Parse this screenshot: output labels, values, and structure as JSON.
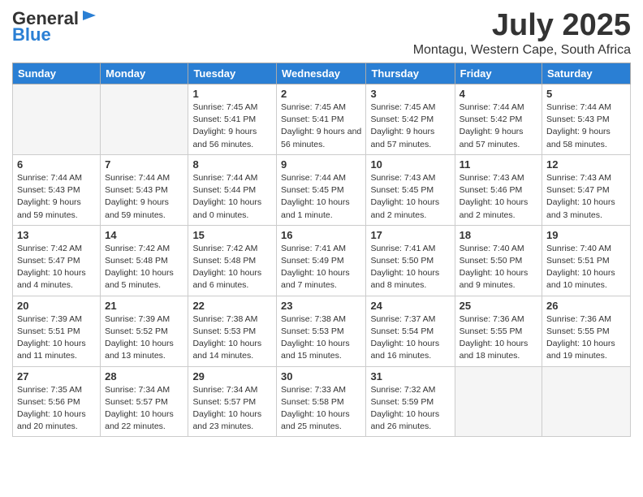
{
  "logo": {
    "general": "General",
    "blue": "Blue"
  },
  "title": "July 2025",
  "location": "Montagu, Western Cape, South Africa",
  "days_of_week": [
    "Sunday",
    "Monday",
    "Tuesday",
    "Wednesday",
    "Thursday",
    "Friday",
    "Saturday"
  ],
  "weeks": [
    [
      {
        "day": "",
        "info": ""
      },
      {
        "day": "",
        "info": ""
      },
      {
        "day": "1",
        "info": "Sunrise: 7:45 AM\nSunset: 5:41 PM\nDaylight: 9 hours and 56 minutes."
      },
      {
        "day": "2",
        "info": "Sunrise: 7:45 AM\nSunset: 5:41 PM\nDaylight: 9 hours and 56 minutes."
      },
      {
        "day": "3",
        "info": "Sunrise: 7:45 AM\nSunset: 5:42 PM\nDaylight: 9 hours and 57 minutes."
      },
      {
        "day": "4",
        "info": "Sunrise: 7:44 AM\nSunset: 5:42 PM\nDaylight: 9 hours and 57 minutes."
      },
      {
        "day": "5",
        "info": "Sunrise: 7:44 AM\nSunset: 5:43 PM\nDaylight: 9 hours and 58 minutes."
      }
    ],
    [
      {
        "day": "6",
        "info": "Sunrise: 7:44 AM\nSunset: 5:43 PM\nDaylight: 9 hours and 59 minutes."
      },
      {
        "day": "7",
        "info": "Sunrise: 7:44 AM\nSunset: 5:43 PM\nDaylight: 9 hours and 59 minutes."
      },
      {
        "day": "8",
        "info": "Sunrise: 7:44 AM\nSunset: 5:44 PM\nDaylight: 10 hours and 0 minutes."
      },
      {
        "day": "9",
        "info": "Sunrise: 7:44 AM\nSunset: 5:45 PM\nDaylight: 10 hours and 1 minute."
      },
      {
        "day": "10",
        "info": "Sunrise: 7:43 AM\nSunset: 5:45 PM\nDaylight: 10 hours and 2 minutes."
      },
      {
        "day": "11",
        "info": "Sunrise: 7:43 AM\nSunset: 5:46 PM\nDaylight: 10 hours and 2 minutes."
      },
      {
        "day": "12",
        "info": "Sunrise: 7:43 AM\nSunset: 5:47 PM\nDaylight: 10 hours and 3 minutes."
      }
    ],
    [
      {
        "day": "13",
        "info": "Sunrise: 7:42 AM\nSunset: 5:47 PM\nDaylight: 10 hours and 4 minutes."
      },
      {
        "day": "14",
        "info": "Sunrise: 7:42 AM\nSunset: 5:48 PM\nDaylight: 10 hours and 5 minutes."
      },
      {
        "day": "15",
        "info": "Sunrise: 7:42 AM\nSunset: 5:48 PM\nDaylight: 10 hours and 6 minutes."
      },
      {
        "day": "16",
        "info": "Sunrise: 7:41 AM\nSunset: 5:49 PM\nDaylight: 10 hours and 7 minutes."
      },
      {
        "day": "17",
        "info": "Sunrise: 7:41 AM\nSunset: 5:50 PM\nDaylight: 10 hours and 8 minutes."
      },
      {
        "day": "18",
        "info": "Sunrise: 7:40 AM\nSunset: 5:50 PM\nDaylight: 10 hours and 9 minutes."
      },
      {
        "day": "19",
        "info": "Sunrise: 7:40 AM\nSunset: 5:51 PM\nDaylight: 10 hours and 10 minutes."
      }
    ],
    [
      {
        "day": "20",
        "info": "Sunrise: 7:39 AM\nSunset: 5:51 PM\nDaylight: 10 hours and 11 minutes."
      },
      {
        "day": "21",
        "info": "Sunrise: 7:39 AM\nSunset: 5:52 PM\nDaylight: 10 hours and 13 minutes."
      },
      {
        "day": "22",
        "info": "Sunrise: 7:38 AM\nSunset: 5:53 PM\nDaylight: 10 hours and 14 minutes."
      },
      {
        "day": "23",
        "info": "Sunrise: 7:38 AM\nSunset: 5:53 PM\nDaylight: 10 hours and 15 minutes."
      },
      {
        "day": "24",
        "info": "Sunrise: 7:37 AM\nSunset: 5:54 PM\nDaylight: 10 hours and 16 minutes."
      },
      {
        "day": "25",
        "info": "Sunrise: 7:36 AM\nSunset: 5:55 PM\nDaylight: 10 hours and 18 minutes."
      },
      {
        "day": "26",
        "info": "Sunrise: 7:36 AM\nSunset: 5:55 PM\nDaylight: 10 hours and 19 minutes."
      }
    ],
    [
      {
        "day": "27",
        "info": "Sunrise: 7:35 AM\nSunset: 5:56 PM\nDaylight: 10 hours and 20 minutes."
      },
      {
        "day": "28",
        "info": "Sunrise: 7:34 AM\nSunset: 5:57 PM\nDaylight: 10 hours and 22 minutes."
      },
      {
        "day": "29",
        "info": "Sunrise: 7:34 AM\nSunset: 5:57 PM\nDaylight: 10 hours and 23 minutes."
      },
      {
        "day": "30",
        "info": "Sunrise: 7:33 AM\nSunset: 5:58 PM\nDaylight: 10 hours and 25 minutes."
      },
      {
        "day": "31",
        "info": "Sunrise: 7:32 AM\nSunset: 5:59 PM\nDaylight: 10 hours and 26 minutes."
      },
      {
        "day": "",
        "info": ""
      },
      {
        "day": "",
        "info": ""
      }
    ]
  ]
}
